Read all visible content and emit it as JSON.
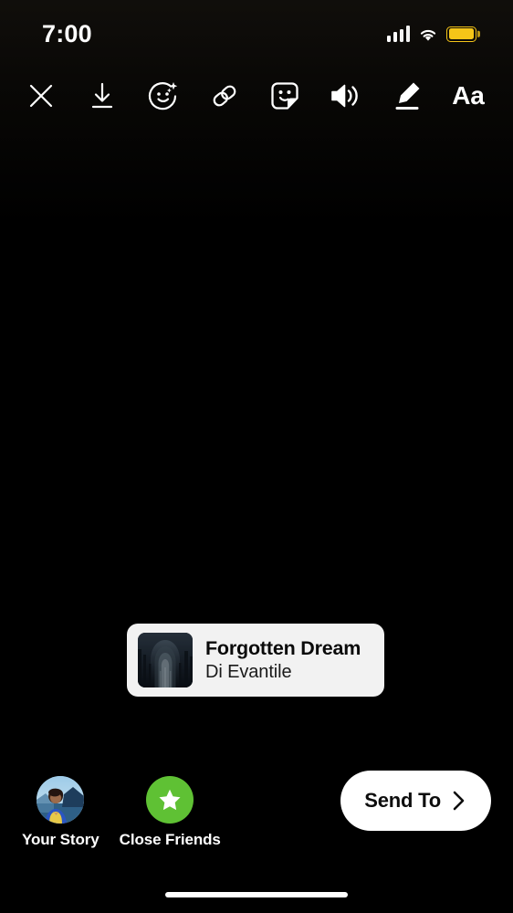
{
  "status_bar": {
    "time": "7:00",
    "cellular_icon": "signal-bars-icon",
    "cellular_bars_filled": 2,
    "cellular_bars_total": 4,
    "wifi_icon": "wifi-icon",
    "battery_icon": "battery-icon",
    "battery_color": "#F5C518",
    "battery_mode": "low-power"
  },
  "toolbar": {
    "close_icon": "close-icon",
    "close_label": "Close",
    "save_icon": "download-icon",
    "save_label": "Save",
    "effects_icon": "smiley-sparkle-icon",
    "effects_label": "Effects",
    "link_icon": "link-icon",
    "link_label": "Link",
    "sticker_icon": "sticker-icon",
    "sticker_label": "Stickers",
    "sound_icon": "speaker-icon",
    "sound_label": "Sound",
    "draw_icon": "marker-pen-icon",
    "draw_label": "Draw",
    "text_icon": "text-icon",
    "text_label": "Aa"
  },
  "canvas": {
    "background_color": "#000000"
  },
  "music_sticker": {
    "title": "Forgotten Dream",
    "artist": "Di Evantile",
    "album_art_icon": "album-art-thumbnail",
    "background_color": "#f2f2f2"
  },
  "bottom_bar": {
    "audience": [
      {
        "label": "Your Story",
        "icon": "avatar",
        "type": "story"
      },
      {
        "label": "Close Friends",
        "icon": "star-icon",
        "type": "close-friends",
        "badge_color": "#5FC134"
      }
    ],
    "send_to": {
      "label": "Send To",
      "chevron_icon": "chevron-right-icon"
    }
  },
  "home_indicator": {
    "icon": "home-indicator-bar"
  }
}
